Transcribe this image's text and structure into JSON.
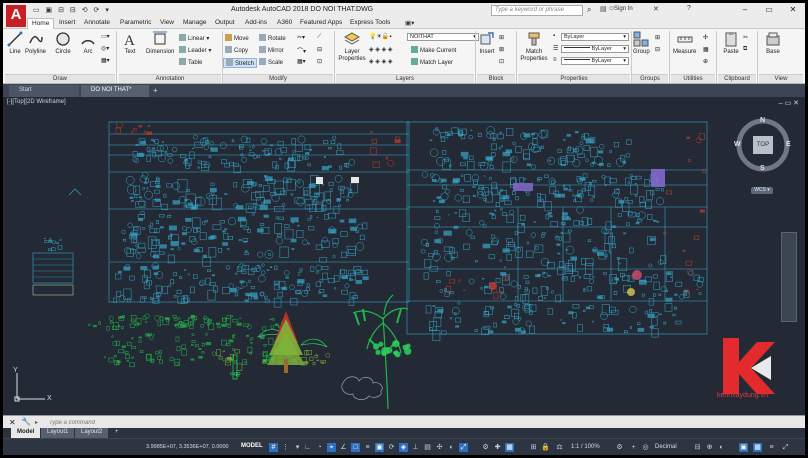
{
  "app": {
    "logo": "A",
    "title": "Autodesk AutoCAD 2018    DO NOI THAT.DWG",
    "search_placeholder": "Type a keyword or phrase",
    "signin": "Sign In",
    "qat_icons": "▭ ▣ ⊟ ⊟ ⟲ ⟳ ▾"
  },
  "ribbon_tabs": [
    "Home",
    "Insert",
    "Annotate",
    "Parametric",
    "View",
    "Manage",
    "Output",
    "Add-ins",
    "A360",
    "Featured Apps",
    "Express Tools"
  ],
  "ribbon": {
    "draw": {
      "line": "Line",
      "polyline": "Polyline",
      "circle": "Circle",
      "arc": "Arc",
      "label": "Draw"
    },
    "annotation": {
      "text": "Text",
      "dimension": "Dimension",
      "linear": "Linear",
      "leader": "Leader",
      "table": "Table",
      "label": "Annotation"
    },
    "modify": {
      "move": "Move",
      "rotate": "Rotate",
      "copy": "Copy",
      "mirror": "Mirror",
      "stretch": "Stretch",
      "scale": "Scale",
      "label": "Modify"
    },
    "layers": {
      "layer_properties": "Layer Properties",
      "current_layer": "NOITHAT",
      "make_current": "Make Current",
      "match_layer": "Match Layer",
      "label": "Layers"
    },
    "block": {
      "insert": "Insert",
      "label": "Block"
    },
    "properties": {
      "match_properties": "Match Properties",
      "color": "ByLayer",
      "linetype": "ByLayer",
      "lineweight": "ByLayer",
      "label": "Properties"
    },
    "groups": {
      "group": "Group",
      "label": "Groups"
    },
    "utilities": {
      "measure": "Measure",
      "label": "Utilities"
    },
    "clipboard": {
      "paste": "Paste",
      "label": "Clipboard"
    },
    "view": {
      "base": "Base",
      "label": "View"
    }
  },
  "file_tabs": {
    "start": "Start",
    "current": "DO NOI THAT*",
    "add": "+"
  },
  "viewport": {
    "label": "[-][Top][2D Wireframe]",
    "controls": "– ▭ ✕",
    "viewcube": {
      "n": "N",
      "s": "S",
      "e": "E",
      "w": "W",
      "face": "TOP",
      "wcs": "WCS ▾"
    }
  },
  "ucs": {
    "x": "X",
    "y": "Y"
  },
  "watermark": {
    "text": "kenhxaydung.vn"
  },
  "command": {
    "placeholder": "Type a command",
    "prompt": "▸"
  },
  "layout_tabs": [
    "Model",
    "Layout1",
    "Layout2",
    "+"
  ],
  "status": {
    "coords": "3.9985E+07, 3.3536E+07, 0.0000",
    "model": "MODEL",
    "scale": "1:1 / 100%",
    "units": "Decimal"
  },
  "colors": {
    "accent": "#c71f25",
    "canvas": "#232a35",
    "cad_cyan": "#36a7c9",
    "cad_red": "#c63b2d",
    "cad_green": "#22b64a"
  }
}
